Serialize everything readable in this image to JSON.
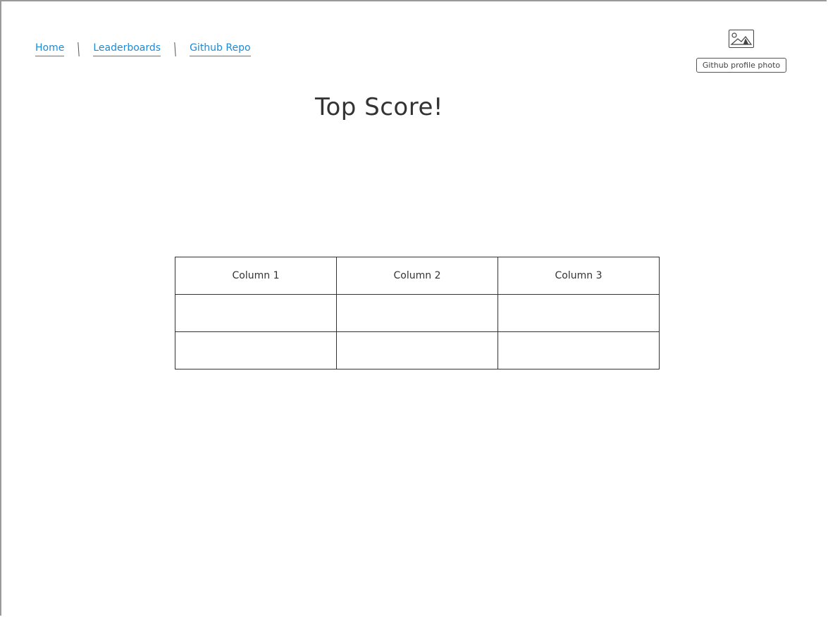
{
  "nav": {
    "items": [
      {
        "label": "Home"
      },
      {
        "label": "Leaderboards"
      },
      {
        "label": "Github Repo"
      }
    ]
  },
  "profile": {
    "label": "Github profile photo",
    "icon": "image-icon"
  },
  "page": {
    "title": "Top Score!"
  },
  "table": {
    "headers": [
      "Column 1",
      "Column 2",
      "Column 3"
    ],
    "rows": [
      [
        "",
        "",
        ""
      ],
      [
        "",
        "",
        ""
      ]
    ]
  },
  "colors": {
    "link": "#1d8ad6",
    "ink": "#333333"
  }
}
